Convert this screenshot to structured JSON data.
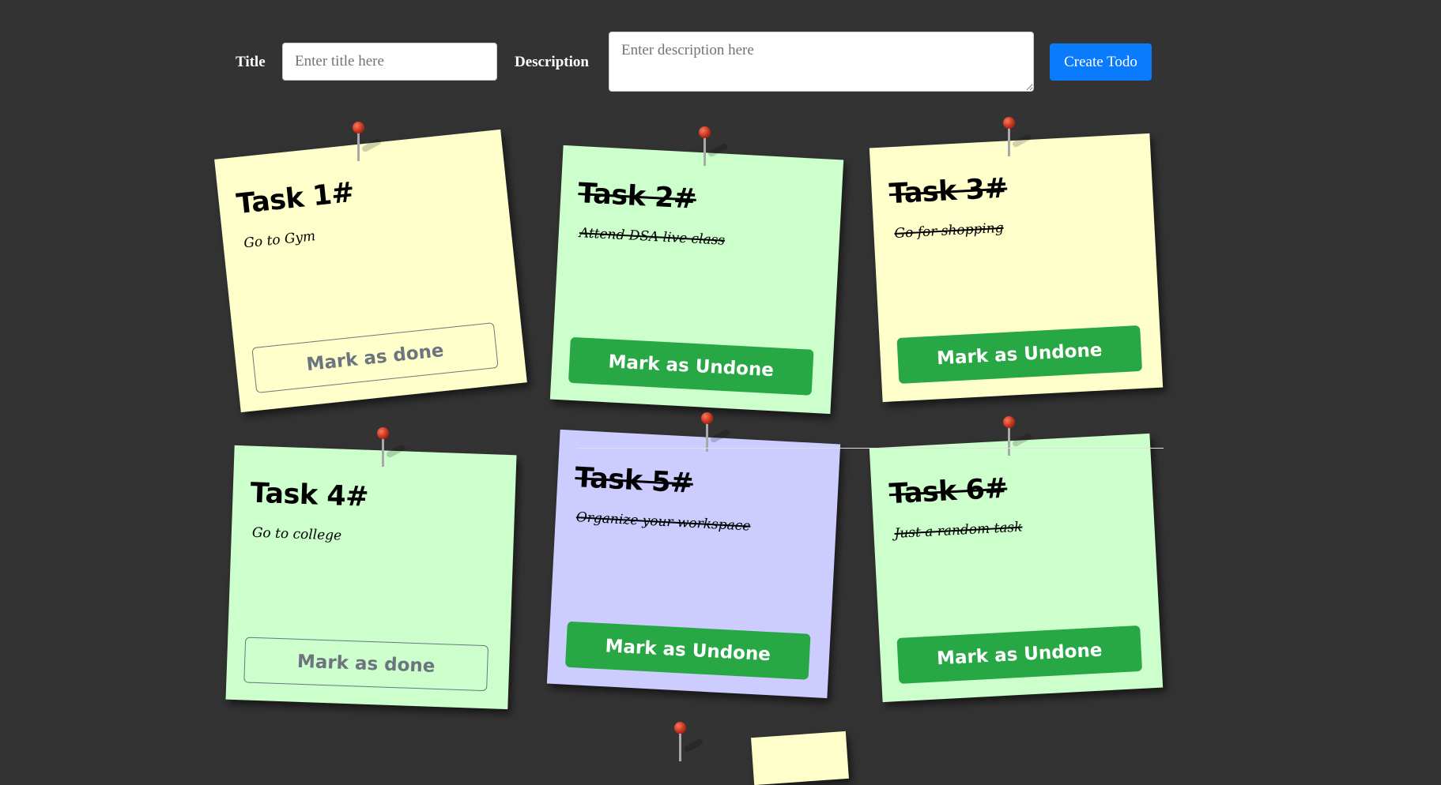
{
  "form": {
    "title_label": "Title",
    "title_placeholder": "Enter title here",
    "description_label": "Description",
    "description_placeholder": "Enter description here",
    "create_button": "Create Todo"
  },
  "colors": {
    "background": "#333333",
    "yellow_note": "#ffffcc",
    "green_note": "#ccffcc",
    "purple_note": "#ccccff",
    "button_green": "#28a745",
    "create_blue": "#0b7bfe"
  },
  "todos": [
    {
      "title": "Task 1#",
      "description": "Go to Gym",
      "completed": false,
      "button": "Mark as done",
      "color": "yellow"
    },
    {
      "title": "Task 2#",
      "description": "Attend DSA live class",
      "completed": true,
      "button": "Mark as Undone",
      "color": "green"
    },
    {
      "title": "Task 3#",
      "description": "Go for shopping",
      "completed": true,
      "button": "Mark as Undone",
      "color": "yellow"
    },
    {
      "title": "Task 4#",
      "description": "Go to college",
      "completed": false,
      "button": "Mark as done",
      "color": "green"
    },
    {
      "title": "Task 5#",
      "description": "Organize your workspace",
      "completed": true,
      "button": "Mark as Undone",
      "color": "purple"
    },
    {
      "title": "Task 6#",
      "description": "Just a random task",
      "completed": true,
      "button": "Mark as Undone",
      "color": "green"
    }
  ]
}
